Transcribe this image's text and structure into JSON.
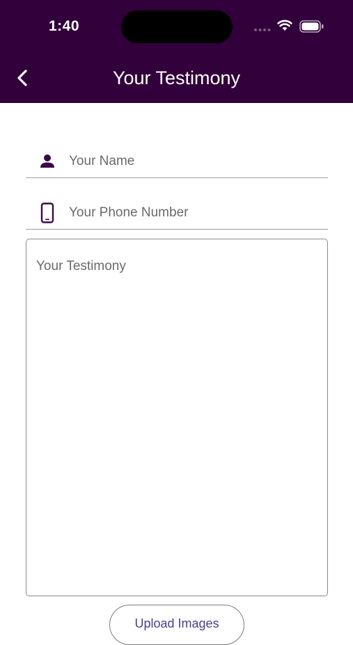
{
  "status_bar": {
    "time": "1:40",
    "icons": [
      "cellular-signal-icon",
      "wifi-icon",
      "battery-icon"
    ]
  },
  "nav": {
    "title": "Your Testimony",
    "back_icon": "chevron-left-icon"
  },
  "form": {
    "name_field": {
      "placeholder": "Your Name",
      "value": "",
      "icon": "person-icon"
    },
    "phone_field": {
      "placeholder": "Your Phone Number",
      "value": "",
      "icon": "smartphone-icon"
    },
    "testimony_field": {
      "placeholder": "Your Testimony",
      "value": ""
    },
    "upload_label": "Upload Images"
  },
  "colors": {
    "app_bar": "#32003a",
    "icon": "#3b0a45",
    "upload_text": "#4a3e8f"
  }
}
